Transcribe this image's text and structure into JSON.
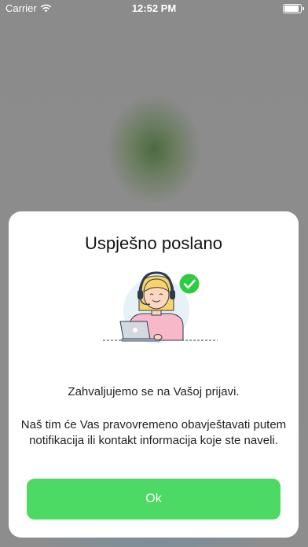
{
  "status_bar": {
    "carrier": "Carrier",
    "time": "12:52 PM",
    "battery_level": 1.0
  },
  "dialog": {
    "title": "Uspješno poslano",
    "message_line1": "Zahvaljujemo se na Vašoj prijavi.",
    "message_line2": "Naš tim će Vas pravovremeno obavještavati putem notifikacija ili kontakt informacija koje ste naveli.",
    "ok_label": "Ok"
  },
  "colors": {
    "accent_green": "#4cd964",
    "check_green": "#2ecc40",
    "illustration_circle": "#e6f1f8"
  }
}
